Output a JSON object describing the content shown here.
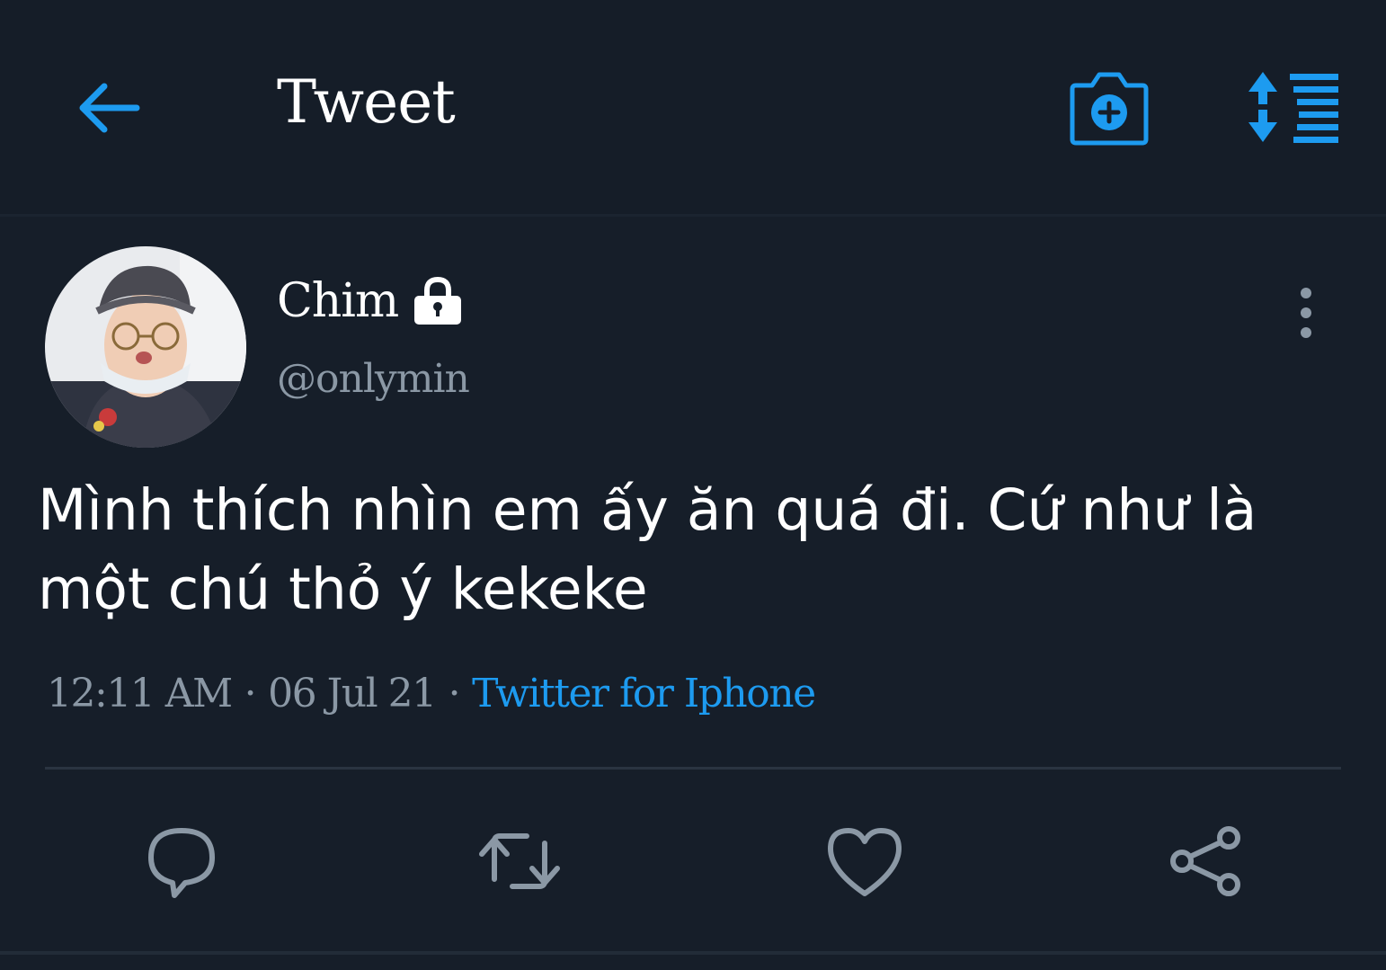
{
  "header": {
    "title": "Tweet",
    "back_icon": "arrow-left-icon",
    "camera_icon": "camera-add-icon",
    "sort_icon": "sort-lines-icon"
  },
  "author": {
    "display_name": "Chim",
    "handle": "@onlymin",
    "protected_icon": "lock-icon"
  },
  "tweet": {
    "text": "Mình thích nhìn em ấy ăn quá đi. Cứ như là một chú thỏ ý kekeke",
    "time": "12:11 AM",
    "date": "06 Jul 21",
    "separator": "·",
    "source": "Twitter for Iphone"
  },
  "actions": [
    {
      "name": "reply",
      "icon": "reply-bubble-icon"
    },
    {
      "name": "retweet",
      "icon": "retweet-icon"
    },
    {
      "name": "like",
      "icon": "heart-icon"
    },
    {
      "name": "share",
      "icon": "share-icon"
    }
  ],
  "colors": {
    "background": "#161e29",
    "accent": "#1d9bf0",
    "secondary_text": "#8b98a5",
    "icon_gray": "#8b98a5"
  }
}
